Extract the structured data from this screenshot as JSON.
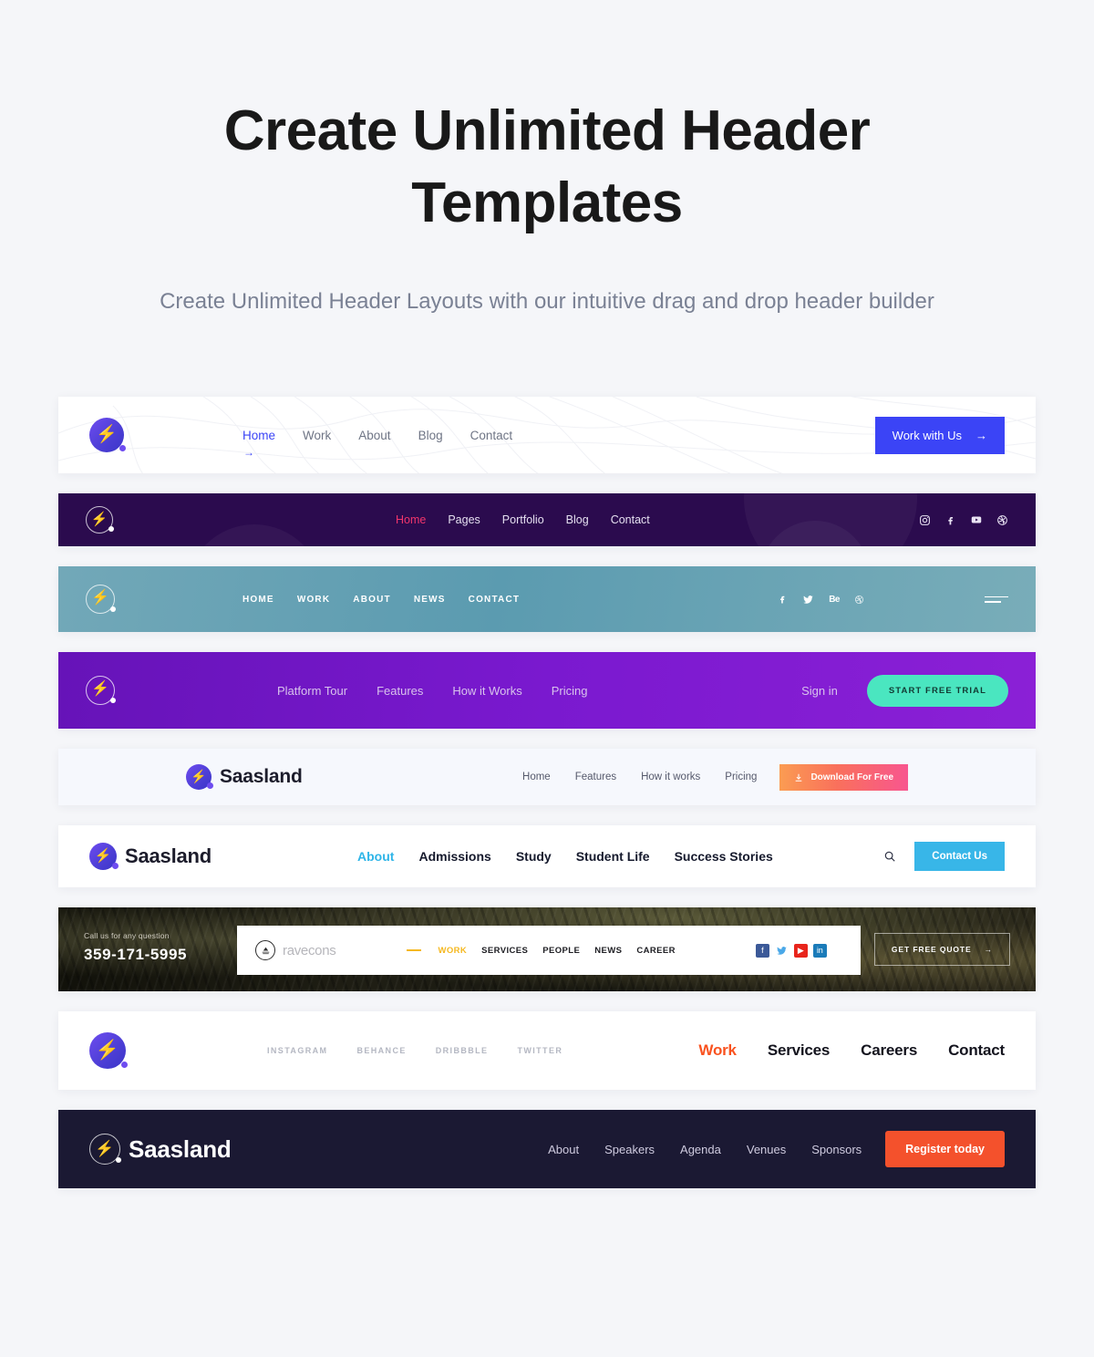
{
  "hero": {
    "title": "Create Unlimited Header Templates",
    "subtitle": "Create Unlimited Header Layouts with our intuitive drag and drop header builder"
  },
  "colors": {
    "page_bg": "#f5f6f9",
    "title": "#191919",
    "subtitle": "#7a8194",
    "blue_button": "#3b44f6",
    "pink_active": "#f2356c",
    "mint_button": "#4ae6c0",
    "cyan_button": "#38b6e8",
    "orange_button": "#f4512c",
    "yellow_active": "#f5b820",
    "orange_active": "#f9521f",
    "dark_purple": "#2b0b4e",
    "teal": "#5b9bb0",
    "violet": "#7a19cf",
    "dark_navy": "#1b1933"
  },
  "headers": [
    {
      "id": "header-light-topography",
      "logo": {
        "icon": "bolt-icon",
        "text": ""
      },
      "nav": [
        {
          "label": "Home",
          "active": true
        },
        {
          "label": "Work",
          "active": false
        },
        {
          "label": "About",
          "active": false
        },
        {
          "label": "Blog",
          "active": false
        },
        {
          "label": "Contact",
          "active": false
        }
      ],
      "cta": {
        "label": "Work with Us",
        "icon": "arrow-right-icon"
      }
    },
    {
      "id": "header-dark-purple",
      "logo": {
        "icon": "bolt-icon",
        "text": ""
      },
      "nav": [
        {
          "label": "Home",
          "active": true
        },
        {
          "label": "Pages",
          "active": false
        },
        {
          "label": "Portfolio",
          "active": false
        },
        {
          "label": "Blog",
          "active": false
        },
        {
          "label": "Contact",
          "active": false
        }
      ],
      "socials": [
        "instagram-icon",
        "facebook-icon",
        "youtube-icon",
        "dribbble-icon"
      ]
    },
    {
      "id": "header-teal",
      "logo": {
        "icon": "bolt-icon",
        "text": ""
      },
      "nav": [
        {
          "label": "HOME",
          "active": false
        },
        {
          "label": "WORK",
          "active": false
        },
        {
          "label": "ABOUT",
          "active": false
        },
        {
          "label": "NEWS",
          "active": false
        },
        {
          "label": "CONTACT",
          "active": false
        }
      ],
      "socials": [
        "facebook-icon",
        "twitter-icon",
        "behance-icon",
        "dribbble-icon"
      ],
      "menu_icon": "hamburger-icon"
    },
    {
      "id": "header-violet",
      "logo": {
        "icon": "bolt-icon",
        "text": ""
      },
      "nav": [
        {
          "label": "Platform Tour",
          "active": false
        },
        {
          "label": "Features",
          "active": false
        },
        {
          "label": "How it Works",
          "active": false
        },
        {
          "label": "Pricing",
          "active": false
        }
      ],
      "signin": "Sign in",
      "cta": {
        "label": "START FREE TRIAL"
      }
    },
    {
      "id": "header-saasland-light",
      "logo": {
        "icon": "bolt-icon",
        "text": "Saasland"
      },
      "nav": [
        {
          "label": "Home",
          "active": false
        },
        {
          "label": "Features",
          "active": false
        },
        {
          "label": "How it works",
          "active": false
        },
        {
          "label": "Pricing",
          "active": false
        }
      ],
      "cta": {
        "label": "Download For Free",
        "icon": "download-icon"
      }
    },
    {
      "id": "header-saasland-education",
      "logo": {
        "icon": "bolt-icon",
        "text": "Saasland"
      },
      "nav": [
        {
          "label": "About",
          "active": true
        },
        {
          "label": "Admissions",
          "active": false
        },
        {
          "label": "Study",
          "active": false
        },
        {
          "label": "Student Life",
          "active": false
        },
        {
          "label": "Success Stories",
          "active": false
        }
      ],
      "search_icon": "search-icon",
      "cta": {
        "label": "Contact Us"
      }
    },
    {
      "id": "header-ravecons-photo",
      "call_label": "Call us for any question",
      "phone": "359-171-5995",
      "logo": {
        "icon": "rave-circle-icon",
        "text": "rave",
        "text_light": "cons"
      },
      "nav": [
        {
          "label": "WORK",
          "active": true
        },
        {
          "label": "SERVICES",
          "active": false
        },
        {
          "label": "PEOPLE",
          "active": false
        },
        {
          "label": "NEWS",
          "active": false
        },
        {
          "label": "CAREER",
          "active": false
        }
      ],
      "socials": [
        "facebook-icon",
        "twitter-icon",
        "youtube-icon",
        "linkedin-icon"
      ],
      "cta": {
        "label": "GET FREE QUOTE",
        "icon": "arrow-right-icon"
      }
    },
    {
      "id": "header-white-agency",
      "logo": {
        "icon": "bolt-icon",
        "text": ""
      },
      "nav_left": [
        {
          "label": "INSTAGRAM"
        },
        {
          "label": "BEHANCE"
        },
        {
          "label": "DRIBBBLE"
        },
        {
          "label": "TWITTER"
        }
      ],
      "nav_right": [
        {
          "label": "Work",
          "active": true
        },
        {
          "label": "Services",
          "active": false
        },
        {
          "label": "Careers",
          "active": false
        },
        {
          "label": "Contact",
          "active": false
        }
      ]
    },
    {
      "id": "header-dark-navy-event",
      "logo": {
        "icon": "bolt-icon",
        "text": "Saasland"
      },
      "nav": [
        {
          "label": "About",
          "active": false
        },
        {
          "label": "Speakers",
          "active": false
        },
        {
          "label": "Agenda",
          "active": false
        },
        {
          "label": "Venues",
          "active": false
        },
        {
          "label": "Sponsors",
          "active": false
        }
      ],
      "cta": {
        "label": "Register today"
      }
    }
  ]
}
